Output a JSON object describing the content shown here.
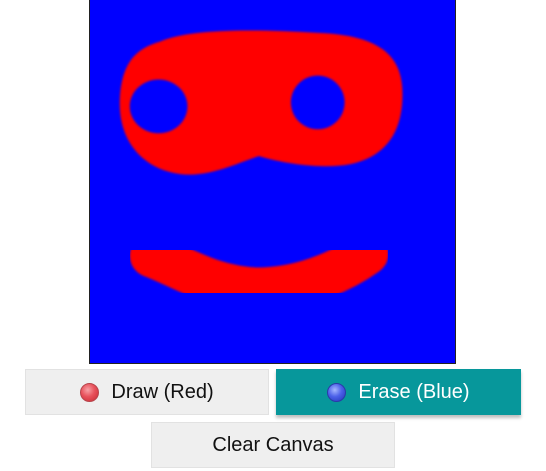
{
  "canvas": {
    "background_color": "#0000ff",
    "paint_color": "#ff0000"
  },
  "controls": {
    "draw_label": "Draw (Red)",
    "draw_icon": "red-dot-icon",
    "erase_label": "Erase (Blue)",
    "erase_icon": "blue-dot-icon",
    "erase_active": true,
    "active_color": "#07979b",
    "clear_label": "Clear Canvas"
  }
}
